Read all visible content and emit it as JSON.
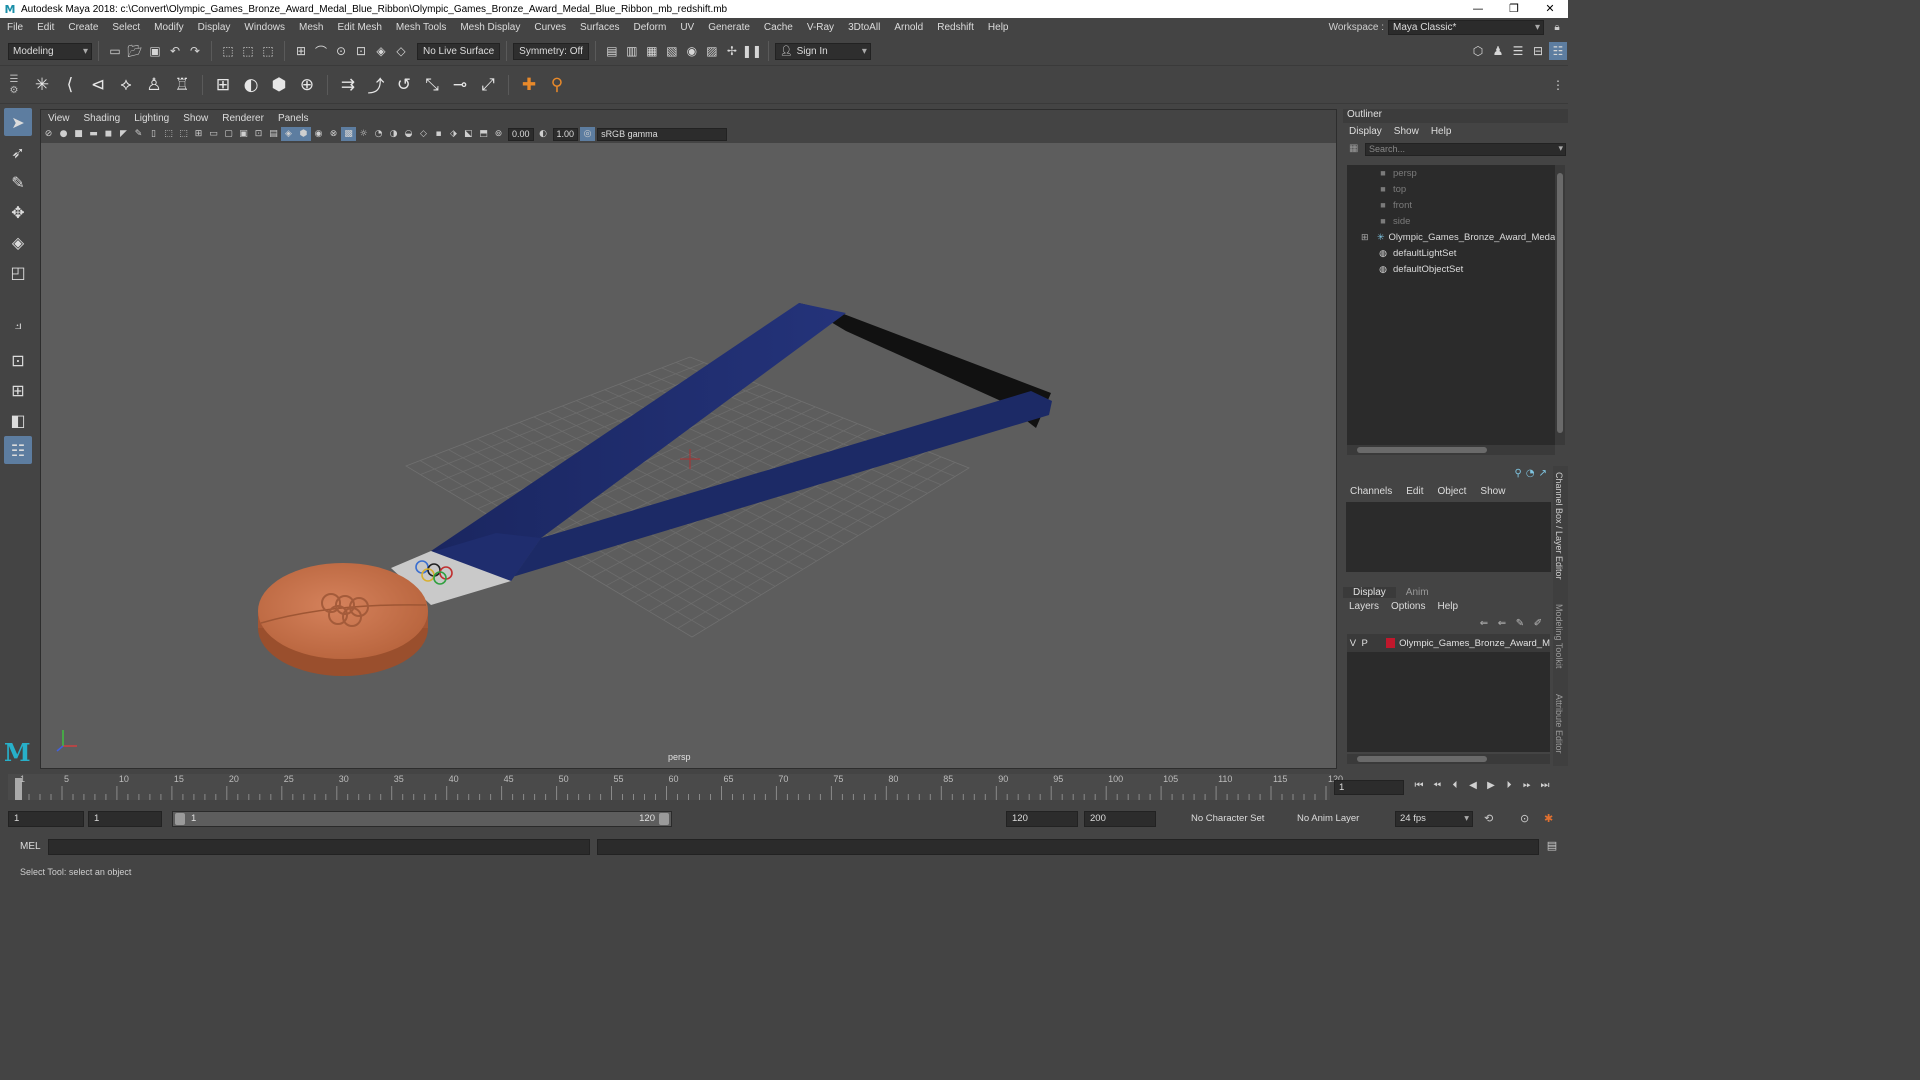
{
  "window": {
    "title": "Autodesk Maya 2018: c:\\Convert\\Olympic_Games_Bronze_Award_Medal_Blue_Ribbon\\Olympic_Games_Bronze_Award_Medal_Blue_Ribbon_mb_redshift.mb",
    "logo": "M",
    "minimize": "—",
    "maximize": "❐",
    "close": "✕"
  },
  "menubar": {
    "items": [
      "File",
      "Edit",
      "Create",
      "Select",
      "Modify",
      "Display",
      "Windows",
      "Mesh",
      "Edit Mesh",
      "Mesh Tools",
      "Mesh Display",
      "Curves",
      "Surfaces",
      "Deform",
      "UV",
      "Generate",
      "Cache",
      "V-Ray",
      "3DtoAll",
      "Arnold",
      "Redshift",
      "Help"
    ],
    "workspace_label": "Workspace :",
    "workspace_value": "Maya Classic*"
  },
  "statusline": {
    "mode": "Modeling",
    "live_surface": "No Live Surface",
    "symmetry": "Symmetry: Off",
    "sign_in": "Sign In"
  },
  "viewport": {
    "menu": [
      "View",
      "Shading",
      "Lighting",
      "Show",
      "Renderer",
      "Panels"
    ],
    "exposure": "0.00",
    "gamma": "1.00",
    "color_space": "sRGB gamma",
    "camera_label": "persp"
  },
  "outliner": {
    "title": "Outliner",
    "menu": [
      "Display",
      "Show",
      "Help"
    ],
    "search_placeholder": "Search...",
    "items": [
      {
        "label": "persp",
        "icon": "camera-icon",
        "dim": true
      },
      {
        "label": "top",
        "icon": "camera-icon",
        "dim": true
      },
      {
        "label": "front",
        "icon": "camera-icon",
        "dim": true
      },
      {
        "label": "side",
        "icon": "camera-icon",
        "dim": true
      },
      {
        "label": "Olympic_Games_Bronze_Award_Medal_B",
        "icon": "group-icon",
        "dim": false,
        "expandable": true
      },
      {
        "label": "defaultLightSet",
        "icon": "set-icon",
        "dim": false
      },
      {
        "label": "defaultObjectSet",
        "icon": "set-icon",
        "dim": false
      }
    ]
  },
  "channelbox": {
    "menu": [
      "Channels",
      "Edit",
      "Object",
      "Show"
    ]
  },
  "layereditor": {
    "tabs": [
      "Display",
      "Anim"
    ],
    "menu": [
      "Layers",
      "Options",
      "Help"
    ],
    "layer": {
      "v": "V",
      "p": "P",
      "name": "Olympic_Games_Bronze_Award_M",
      "color": "#c0182c"
    }
  },
  "sidetabs": [
    "Channel Box / Layer Editor",
    "Modeling Toolkit",
    "Attribute Editor"
  ],
  "timeline": {
    "ticks": [
      "1",
      "5",
      "10",
      "15",
      "20",
      "25",
      "30",
      "35",
      "40",
      "45",
      "50",
      "55",
      "60",
      "65",
      "70",
      "75",
      "80",
      "85",
      "90",
      "95",
      "100",
      "105",
      "110",
      "115",
      "120"
    ],
    "current_frame": "1"
  },
  "range": {
    "start": "1",
    "playback_start": "1",
    "slider_start": "1",
    "slider_end": "120",
    "playback_end": "120",
    "end": "200",
    "character_set": "No Character Set",
    "anim_layer": "No Anim Layer",
    "fps": "24 fps"
  },
  "cmdline": {
    "label": "MEL"
  },
  "helpline": {
    "text": "Select Tool: select an object"
  },
  "colors": {
    "ribbon": "#1c2a66",
    "medal": "#c06a44",
    "accent": "#5d7da0"
  }
}
